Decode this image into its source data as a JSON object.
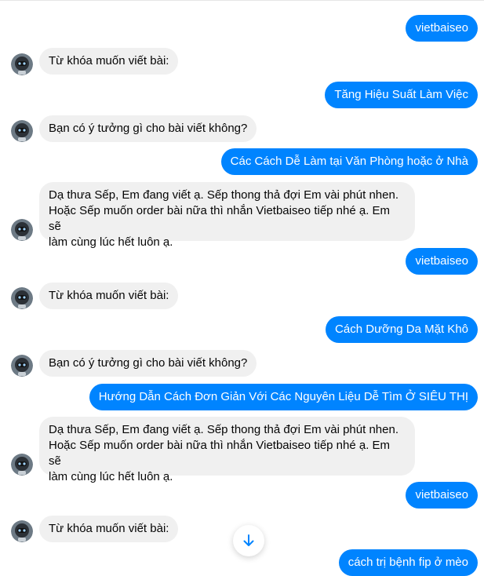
{
  "messages": [
    {
      "from": "user",
      "text": "vietbaiseo"
    },
    {
      "from": "bot",
      "text": "Từ khóa muốn viết bài:"
    },
    {
      "from": "user",
      "text": "Tăng Hiệu Suất Làm Việc"
    },
    {
      "from": "bot",
      "text": "Bạn có ý tưởng gì cho bài viết không?"
    },
    {
      "from": "user",
      "text": "Các Cách Dễ Làm tại Văn Phòng hoặc ở Nhà"
    },
    {
      "from": "bot",
      "lines": [
        "Dạ thưa Sếp, Em đang viết ạ. Sếp thong thả đợi Em vài phút nhen.",
        "Hoặc Sếp muốn order bài nữa thì nhắn Vietbaiseo tiếp nhé ạ. Em sẽ",
        "làm cùng lúc hết luôn ạ."
      ]
    },
    {
      "from": "user",
      "text": "vietbaiseo"
    },
    {
      "from": "bot",
      "text": "Từ khóa muốn viết bài:"
    },
    {
      "from": "user",
      "text": "Cách Dưỡng Da Mặt Khô"
    },
    {
      "from": "bot",
      "text": "Bạn có ý tưởng gì cho bài viết không?"
    },
    {
      "from": "user",
      "text": "Hướng Dẫn Cách  Đơn Giản Với Các Nguyên Liệu Dễ Tìm Ở SIÊU THỊ"
    },
    {
      "from": "bot",
      "lines": [
        "Dạ thưa Sếp, Em đang viết ạ. Sếp thong thả đợi Em vài phút nhen.",
        "Hoặc Sếp muốn order bài nữa thì nhắn Vietbaiseo tiếp nhé ạ. Em sẽ",
        "làm cùng lúc hết luôn ạ."
      ]
    },
    {
      "from": "user",
      "text": "vietbaiseo"
    },
    {
      "from": "bot",
      "text": "Từ khóa muốn viết bài:"
    },
    {
      "from": "user",
      "text": "cách trị bệnh fip ở mèo"
    }
  ],
  "colors": {
    "outgoing_bubble": "#0084ff",
    "incoming_bubble": "#f0f0f0",
    "scroll_arrow": "#0084ff"
  },
  "icons": {
    "avatar": "robot-avatar-icon",
    "scroll": "arrow-down-icon"
  }
}
